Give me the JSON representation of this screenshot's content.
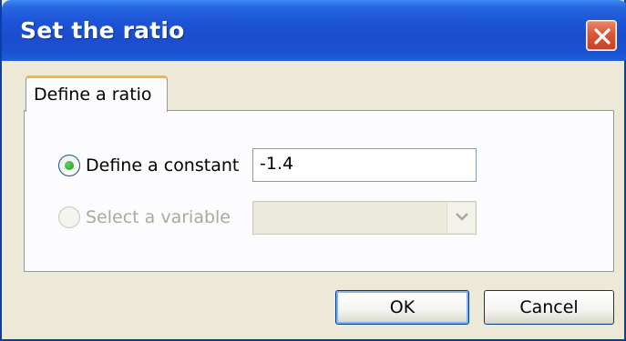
{
  "dialog": {
    "title": "Set the ratio"
  },
  "tab": {
    "label": "Define a ratio"
  },
  "options": {
    "constant": {
      "label": "Define a constant",
      "selected": true,
      "value": "-1.4"
    },
    "variable": {
      "label": "Select a variable",
      "selected": false,
      "enabled": false,
      "value": ""
    }
  },
  "buttons": {
    "ok": "OK",
    "cancel": "Cancel"
  },
  "icons": {
    "close": "close-icon",
    "dropdown": "chevron-down-icon"
  },
  "colors": {
    "titlebar": "#1c54d6",
    "close_button": "#d8593a",
    "tab_accent": "#f5b43c",
    "radio_selected": "#21a121"
  }
}
